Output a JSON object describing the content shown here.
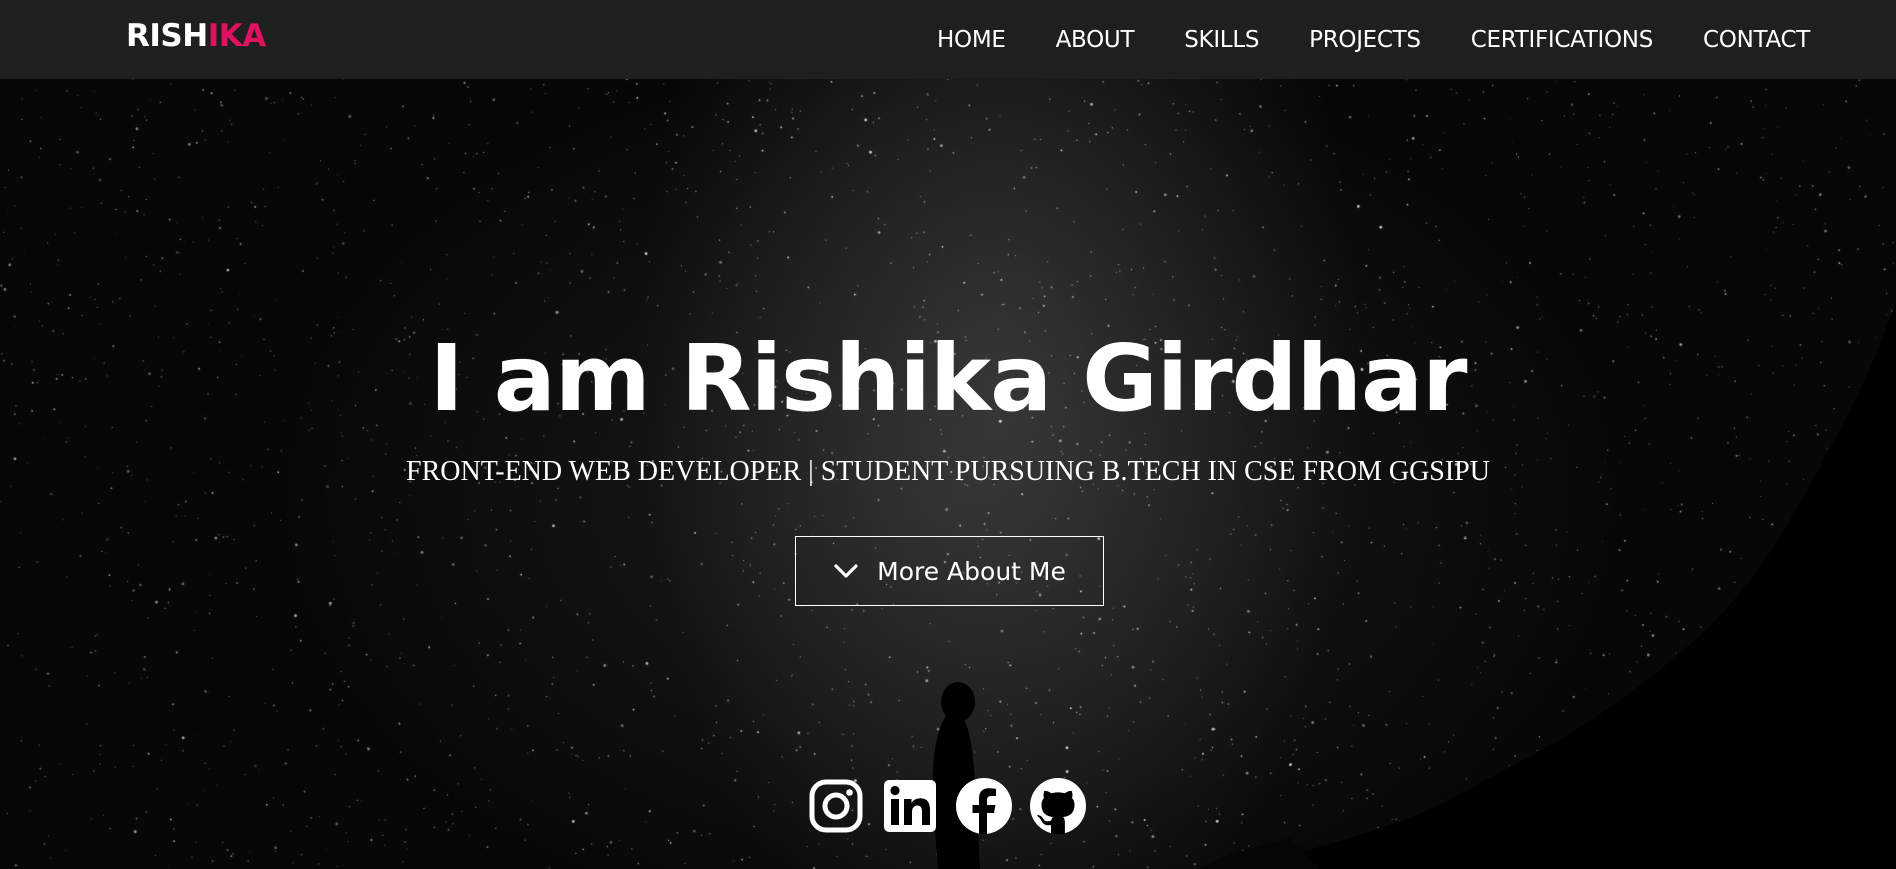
{
  "navbar": {
    "logo_part1": "RISH",
    "logo_part2": "IKA",
    "links": [
      "HOME",
      "ABOUT",
      "SKILLS",
      "PROJECTS",
      "CERTIFICATIONS",
      "CONTACT"
    ]
  },
  "hero": {
    "title": "I am Rishika Girdhar",
    "subtitle": "FRONT-END WEB DEVELOPER | STUDENT PURSUING B.TECH IN CSE FROM GGSIPU",
    "button_label": "More About Me",
    "button_icon": "chevron-down-icon"
  },
  "social": {
    "icons": [
      "instagram-icon",
      "linkedin-icon",
      "facebook-icon",
      "github-icon"
    ]
  },
  "colors": {
    "accent": "#e0115f",
    "navbar_bg": "#1f1f1f",
    "text": "#ffffff"
  }
}
